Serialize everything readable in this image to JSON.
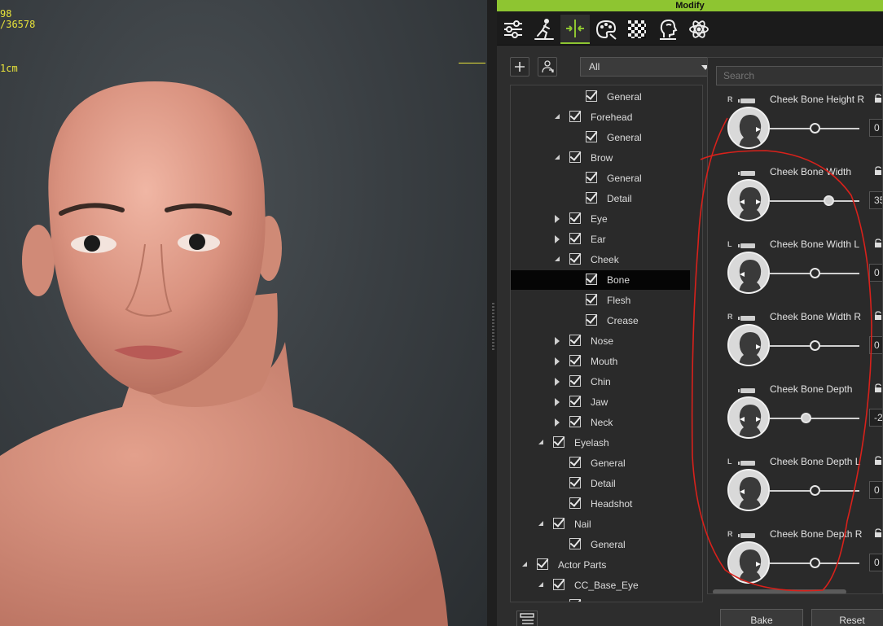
{
  "viewport": {
    "readout_line1": "98",
    "readout_line2": "/36578",
    "readout_scale": "1cm"
  },
  "panel": {
    "title": "Modify",
    "tabs": [
      {
        "icon": "sliders-icon"
      },
      {
        "icon": "motion-icon"
      },
      {
        "icon": "morph-icon",
        "active": true
      },
      {
        "icon": "palette-icon"
      },
      {
        "icon": "checker-icon"
      },
      {
        "icon": "head-icon"
      },
      {
        "icon": "atom-icon"
      }
    ],
    "accent_color": "#8ec531"
  },
  "tree": {
    "filter_value": "All",
    "rows": [
      {
        "label": "General",
        "expander": "none",
        "level": 3
      },
      {
        "label": "Forehead",
        "expander": "expanded",
        "level": 2
      },
      {
        "label": "General",
        "expander": "none",
        "level": 3
      },
      {
        "label": "Brow",
        "expander": "expanded",
        "level": 2
      },
      {
        "label": "General",
        "expander": "none",
        "level": 3
      },
      {
        "label": "Detail",
        "expander": "none",
        "level": 3
      },
      {
        "label": "Eye",
        "expander": "collapsed",
        "level": 2
      },
      {
        "label": "Ear",
        "expander": "collapsed",
        "level": 2
      },
      {
        "label": "Cheek",
        "expander": "expanded",
        "level": 2
      },
      {
        "label": "Bone",
        "expander": "none",
        "level": 3,
        "selected": true
      },
      {
        "label": "Flesh",
        "expander": "none",
        "level": 3
      },
      {
        "label": "Crease",
        "expander": "none",
        "level": 3
      },
      {
        "label": "Nose",
        "expander": "collapsed",
        "level": 2
      },
      {
        "label": "Mouth",
        "expander": "collapsed",
        "level": 2
      },
      {
        "label": "Chin",
        "expander": "collapsed",
        "level": 2
      },
      {
        "label": "Jaw",
        "expander": "collapsed",
        "level": 2
      },
      {
        "label": "Neck",
        "expander": "collapsed",
        "level": 2
      },
      {
        "label": "Eyelash",
        "expander": "expanded",
        "level": 1
      },
      {
        "label": "General",
        "expander": "none",
        "level": 2
      },
      {
        "label": "Detail",
        "expander": "none",
        "level": 2
      },
      {
        "label": "Headshot",
        "expander": "none",
        "level": 2
      },
      {
        "label": "Nail",
        "expander": "expanded",
        "level": 1
      },
      {
        "label": "General",
        "expander": "none",
        "level": 2
      },
      {
        "label": "Actor Parts",
        "expander": "expanded",
        "level": 0
      },
      {
        "label": "CC_Base_Eye",
        "expander": "expanded",
        "level": 1
      },
      {
        "label": "",
        "expander": "none",
        "level": 2
      }
    ]
  },
  "sliders": {
    "search_placeholder": "Search",
    "items": [
      {
        "label": "Cheek Bone Height R",
        "side": "R",
        "value": "0",
        "fraction": 0.5,
        "mark": "right"
      },
      {
        "label": "Cheek Bone Width",
        "side": "",
        "value": "35",
        "fraction": 0.65,
        "mark": "both",
        "filled": true
      },
      {
        "label": "Cheek Bone Width L",
        "side": "L",
        "value": "0",
        "fraction": 0.5,
        "mark": "left"
      },
      {
        "label": "Cheek Bone Width R",
        "side": "R",
        "value": "0",
        "fraction": 0.5,
        "mark": "right"
      },
      {
        "label": "Cheek Bone Depth",
        "side": "",
        "value": "-2",
        "fraction": 0.4,
        "mark": "both",
        "filled": true
      },
      {
        "label": "Cheek Bone Depth L",
        "side": "L",
        "value": "0",
        "fraction": 0.5,
        "mark": "left"
      },
      {
        "label": "Cheek Bone Depth R",
        "side": "R",
        "value": "0",
        "fraction": 0.5,
        "mark": "right"
      }
    ]
  },
  "buttons": {
    "bake": "Bake",
    "reset": "Reset"
  }
}
